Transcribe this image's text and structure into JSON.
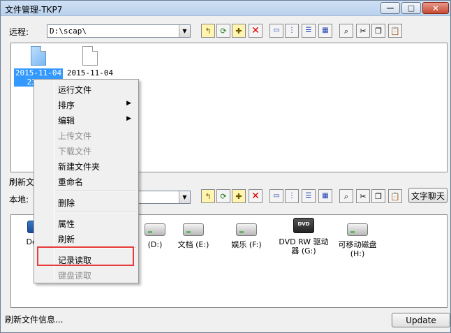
{
  "window": {
    "title": "文件管理-TKP7",
    "controls": {
      "minimize": "—",
      "maximize": "□",
      "close": "✕"
    }
  },
  "remote": {
    "label": "远程:",
    "path": "D:\\scap\\",
    "files": [
      {
        "label": "2015-11-04\n23_07",
        "icon": "file-blue-icon",
        "selected": true
      },
      {
        "label": "2015-11-04",
        "icon": "file-white-icon",
        "selected": false
      }
    ],
    "status_partial": "刷新文"
  },
  "local": {
    "label": "本地:",
    "chat_button": "文字聊天",
    "drives": [
      {
        "label": "Des",
        "icon": "desktop-icon"
      },
      {
        "label": "(D:)",
        "icon": "hard-drive-icon"
      },
      {
        "label": "文档 (E:)",
        "icon": "hard-drive-icon"
      },
      {
        "label": "娱乐 (F:)",
        "icon": "hard-drive-icon"
      },
      {
        "label": "DVD RW 驱动\n器 (G:)",
        "icon": "dvd-drive-icon"
      },
      {
        "label": "可移动磁盘\n(H:)",
        "icon": "removable-disk-icon"
      }
    ]
  },
  "toolbar_icons": [
    "folder-up-icon",
    "refresh-icon",
    "new-folder-icon",
    "delete-icon",
    "large-icons-view-icon",
    "small-icons-view-icon",
    "list-view-icon",
    "details-view-icon",
    "search-icon",
    "cut-icon",
    "copy-icon",
    "paste-icon"
  ],
  "context_menu": {
    "items": [
      {
        "label": "运行文件",
        "disabled": false,
        "submenu": false
      },
      {
        "label": "排序",
        "disabled": false,
        "submenu": true
      },
      {
        "label": "编辑",
        "disabled": false,
        "submenu": true
      },
      {
        "label": "上传文件",
        "disabled": true,
        "submenu": false
      },
      {
        "label": "下载文件",
        "disabled": true,
        "submenu": false
      },
      {
        "label": "新建文件夹",
        "disabled": false,
        "submenu": false
      },
      {
        "label": "重命名",
        "disabled": false,
        "submenu": false
      },
      {
        "label": "删除",
        "disabled": false,
        "submenu": false
      },
      {
        "label": "属性",
        "disabled": false,
        "submenu": false
      },
      {
        "label": "刷新",
        "disabled": false,
        "submenu": false
      },
      {
        "label": "记录读取",
        "disabled": false,
        "submenu": false,
        "highlighted": true
      },
      {
        "label": "键盘读取",
        "disabled": true,
        "submenu": false
      }
    ],
    "arrow": "▶"
  },
  "status": {
    "text": "刷新文件信息...",
    "update_button": "Update"
  },
  "dropdown_arrow": "▼",
  "highlight_color": "#e83b3b"
}
